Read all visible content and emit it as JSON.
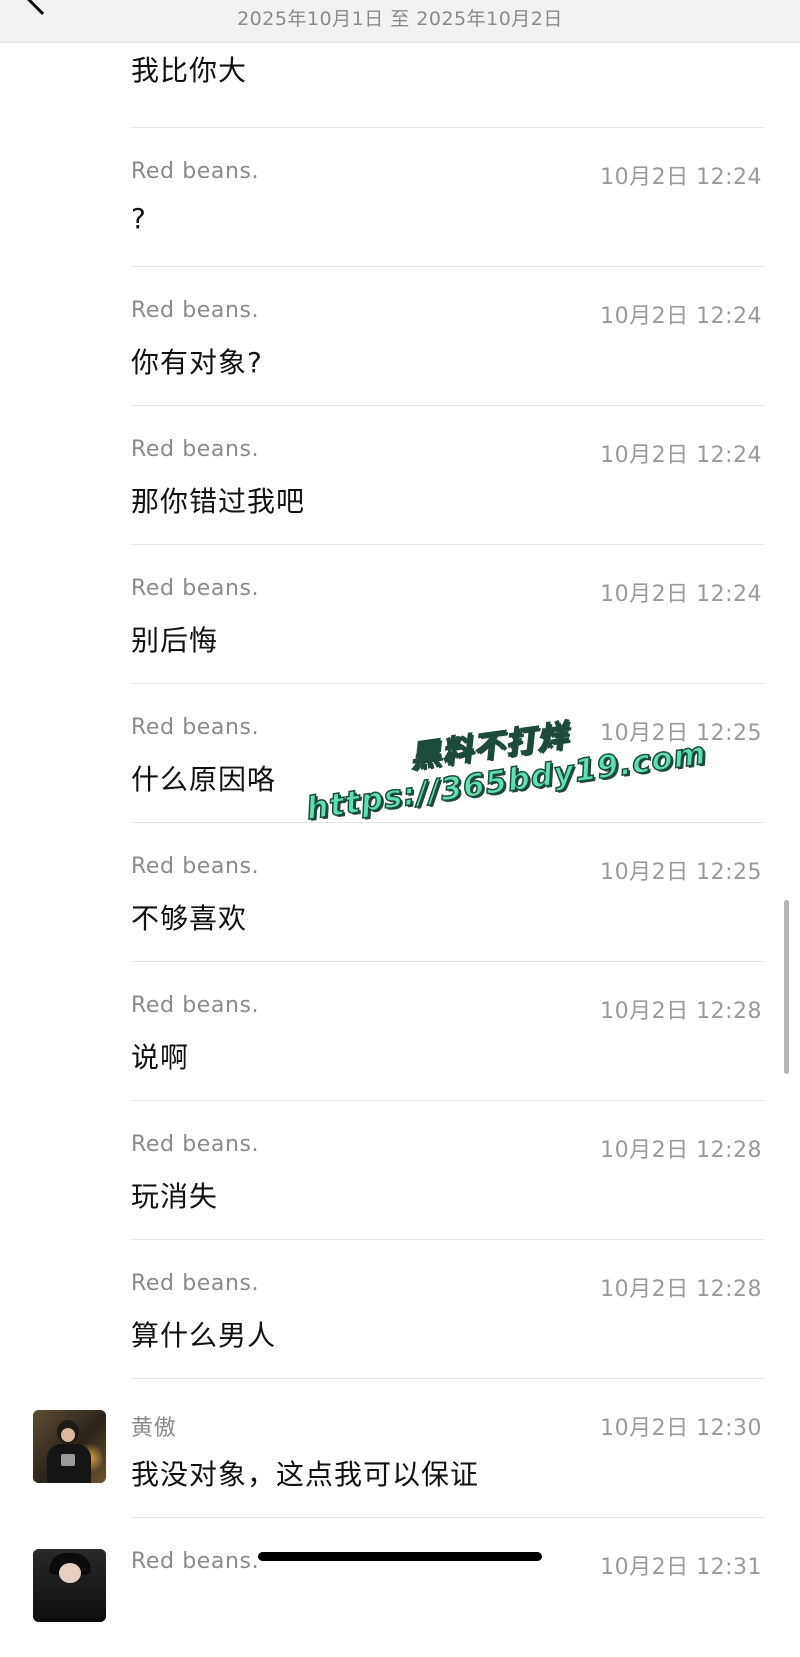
{
  "header": {
    "date_range": "2025年10月1日 至 2025年10月2日"
  },
  "messages": [
    {
      "sender": "",
      "time": "",
      "text": "我比你大"
    },
    {
      "sender": "Red  beans.",
      "time": "10月2日 12:24",
      "text": "?"
    },
    {
      "sender": "Red  beans.",
      "time": "10月2日 12:24",
      "text": "你有对象?"
    },
    {
      "sender": "Red  beans.",
      "time": "10月2日 12:24",
      "text": "那你错过我吧"
    },
    {
      "sender": "Red  beans.",
      "time": "10月2日 12:24",
      "text": "别后悔"
    },
    {
      "sender": "Red  beans.",
      "time": "10月2日 12:25",
      "text": "什么原因咯"
    },
    {
      "sender": "Red  beans.",
      "time": "10月2日 12:25",
      "text": "不够喜欢"
    },
    {
      "sender": "Red  beans.",
      "time": "10月2日 12:28",
      "text": "说啊"
    },
    {
      "sender": "Red  beans.",
      "time": "10月2日 12:28",
      "text": "玩消失"
    },
    {
      "sender": "Red  beans.",
      "time": "10月2日 12:28",
      "text": "算什么男人"
    },
    {
      "sender": "黄傲",
      "time": "10月2日 12:30",
      "text": "我没对象，这点我可以保证"
    },
    {
      "sender": "Red  beans.",
      "time": "10月2日 12:31",
      "text": ""
    }
  ],
  "watermark": {
    "line1": "黑料不打烊",
    "line2": "https://365bdy19.com"
  }
}
